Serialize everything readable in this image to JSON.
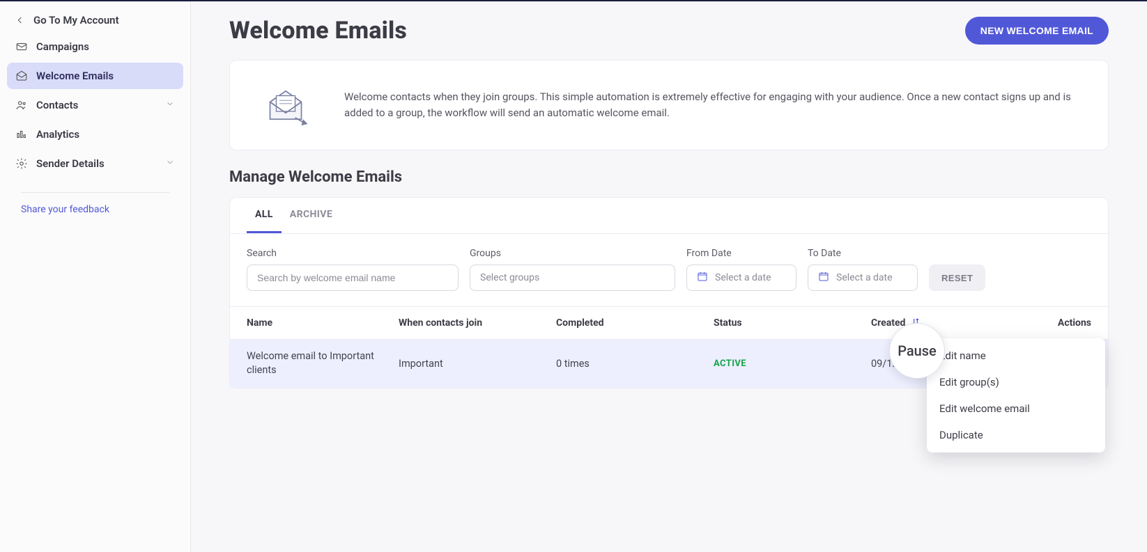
{
  "sidebar": {
    "account_link": "Go To My Account",
    "items": [
      {
        "label": "Campaigns"
      },
      {
        "label": "Welcome Emails"
      },
      {
        "label": "Contacts"
      },
      {
        "label": "Analytics"
      },
      {
        "label": "Sender Details"
      }
    ],
    "feedback": "Share your feedback"
  },
  "header": {
    "title": "Welcome Emails",
    "new_button": "NEW WELCOME EMAIL"
  },
  "intro": {
    "text": "Welcome contacts when they join groups. This simple automation is extremely effective for engaging with your audience. Once a new contact signs up and is added to a group, the workflow will send an automatic welcome email."
  },
  "section_title": "Manage Welcome Emails",
  "tabs": {
    "all": "ALL",
    "archive": "ARCHIVE"
  },
  "filters": {
    "search_label": "Search",
    "search_placeholder": "Search by welcome email name",
    "groups_label": "Groups",
    "groups_placeholder": "Select groups",
    "from_label": "From Date",
    "from_placeholder": "Select a date",
    "to_label": "To Date",
    "to_placeholder": "Select a date",
    "reset": "RESET"
  },
  "table": {
    "headers": {
      "name": "Name",
      "when": "When contacts join",
      "completed": "Completed",
      "status": "Status",
      "created": "Created",
      "actions": "Actions"
    },
    "rows": [
      {
        "name": "Welcome email to Important clients",
        "when": "Important",
        "completed": "0 times",
        "status": "ACTIVE",
        "created": "09/12/2024"
      }
    ]
  },
  "actions_menu": {
    "pause_tooltip": "Pause",
    "items": [
      "Edit name",
      "Edit group(s)",
      "Edit welcome email",
      "Duplicate"
    ]
  },
  "colors": {
    "primary": "#5158d8",
    "active_nav_bg": "#d9dcf9",
    "status_active": "#14a34a"
  }
}
